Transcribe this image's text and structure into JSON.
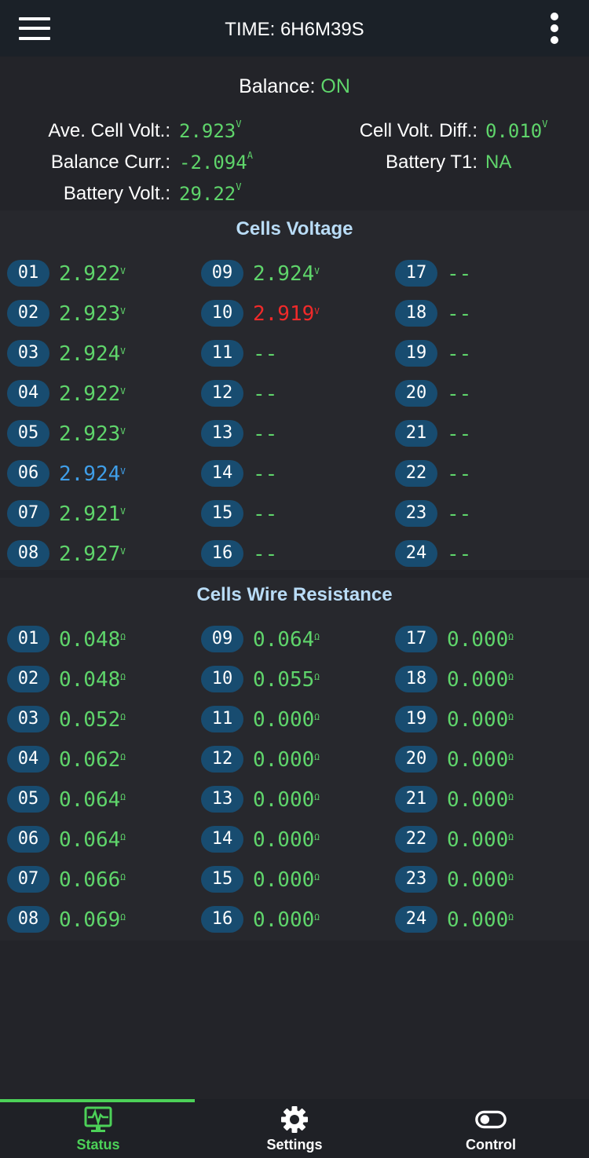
{
  "header": {
    "title": "TIME: 6H6M39S"
  },
  "summary": {
    "balance_label": "Balance: ",
    "balance_value": "ON",
    "ave_cell_volt_label": "Ave. Cell Volt.:",
    "ave_cell_volt_value": "2.923",
    "ave_cell_volt_unit": "V",
    "cell_volt_diff_label": "Cell Volt. Diff.:",
    "cell_volt_diff_value": "0.010",
    "cell_volt_diff_unit": "V",
    "balance_curr_label": "Balance Curr.:",
    "balance_curr_value": "-2.094",
    "balance_curr_unit": "A",
    "battery_t1_label": "Battery T1:",
    "battery_t1_value": "NA",
    "battery_volt_label": "Battery Volt.:",
    "battery_volt_value": "29.22",
    "battery_volt_unit": "V"
  },
  "cells_voltage": {
    "title": "Cells Voltage",
    "unit": "V",
    "items": [
      {
        "id": "01",
        "value": "2.922",
        "unit": "V",
        "color": "#5fd56b"
      },
      {
        "id": "02",
        "value": "2.923",
        "unit": "V",
        "color": "#5fd56b"
      },
      {
        "id": "03",
        "value": "2.924",
        "unit": "V",
        "color": "#5fd56b"
      },
      {
        "id": "04",
        "value": "2.922",
        "unit": "V",
        "color": "#5fd56b"
      },
      {
        "id": "05",
        "value": "2.923",
        "unit": "V",
        "color": "#5fd56b"
      },
      {
        "id": "06",
        "value": "2.924",
        "unit": "V",
        "color": "#3f9ee8"
      },
      {
        "id": "07",
        "value": "2.921",
        "unit": "V",
        "color": "#5fd56b"
      },
      {
        "id": "08",
        "value": "2.927",
        "unit": "V",
        "color": "#5fd56b"
      },
      {
        "id": "09",
        "value": "2.924",
        "unit": "V",
        "color": "#5fd56b"
      },
      {
        "id": "10",
        "value": "2.919",
        "unit": "V",
        "color": "#f02a2a"
      },
      {
        "id": "11",
        "value": "--",
        "unit": "",
        "color": "#5fd56b"
      },
      {
        "id": "12",
        "value": "--",
        "unit": "",
        "color": "#5fd56b"
      },
      {
        "id": "13",
        "value": "--",
        "unit": "",
        "color": "#5fd56b"
      },
      {
        "id": "14",
        "value": "--",
        "unit": "",
        "color": "#5fd56b"
      },
      {
        "id": "15",
        "value": "--",
        "unit": "",
        "color": "#5fd56b"
      },
      {
        "id": "16",
        "value": "--",
        "unit": "",
        "color": "#5fd56b"
      },
      {
        "id": "17",
        "value": "--",
        "unit": "",
        "color": "#5fd56b"
      },
      {
        "id": "18",
        "value": "--",
        "unit": "",
        "color": "#5fd56b"
      },
      {
        "id": "19",
        "value": "--",
        "unit": "",
        "color": "#5fd56b"
      },
      {
        "id": "20",
        "value": "--",
        "unit": "",
        "color": "#5fd56b"
      },
      {
        "id": "21",
        "value": "--",
        "unit": "",
        "color": "#5fd56b"
      },
      {
        "id": "22",
        "value": "--",
        "unit": "",
        "color": "#5fd56b"
      },
      {
        "id": "23",
        "value": "--",
        "unit": "",
        "color": "#5fd56b"
      },
      {
        "id": "24",
        "value": "--",
        "unit": "",
        "color": "#5fd56b"
      }
    ]
  },
  "cells_resistance": {
    "title": "Cells Wire Resistance",
    "items": [
      {
        "id": "01",
        "value": "0.048",
        "unit": "Ω"
      },
      {
        "id": "02",
        "value": "0.048",
        "unit": "Ω"
      },
      {
        "id": "03",
        "value": "0.052",
        "unit": "Ω"
      },
      {
        "id": "04",
        "value": "0.062",
        "unit": "Ω"
      },
      {
        "id": "05",
        "value": "0.064",
        "unit": "Ω"
      },
      {
        "id": "06",
        "value": "0.064",
        "unit": "Ω"
      },
      {
        "id": "07",
        "value": "0.066",
        "unit": "Ω"
      },
      {
        "id": "08",
        "value": "0.069",
        "unit": "Ω"
      },
      {
        "id": "09",
        "value": "0.064",
        "unit": "Ω"
      },
      {
        "id": "10",
        "value": "0.055",
        "unit": "Ω"
      },
      {
        "id": "11",
        "value": "0.000",
        "unit": "Ω"
      },
      {
        "id": "12",
        "value": "0.000",
        "unit": "Ω"
      },
      {
        "id": "13",
        "value": "0.000",
        "unit": "Ω"
      },
      {
        "id": "14",
        "value": "0.000",
        "unit": "Ω"
      },
      {
        "id": "15",
        "value": "0.000",
        "unit": "Ω"
      },
      {
        "id": "16",
        "value": "0.000",
        "unit": "Ω"
      },
      {
        "id": "17",
        "value": "0.000",
        "unit": "Ω"
      },
      {
        "id": "18",
        "value": "0.000",
        "unit": "Ω"
      },
      {
        "id": "19",
        "value": "0.000",
        "unit": "Ω"
      },
      {
        "id": "20",
        "value": "0.000",
        "unit": "Ω"
      },
      {
        "id": "21",
        "value": "0.000",
        "unit": "Ω"
      },
      {
        "id": "22",
        "value": "0.000",
        "unit": "Ω"
      },
      {
        "id": "23",
        "value": "0.000",
        "unit": "Ω"
      },
      {
        "id": "24",
        "value": "0.000",
        "unit": "Ω"
      }
    ]
  },
  "nav": {
    "status_label": "Status",
    "settings_label": "Settings",
    "control_label": "Control",
    "active": "Status",
    "accent_color": "#4cd158",
    "status_icon": "monitor-pulse-icon",
    "settings_icon": "gear-icon",
    "control_icon": "toggle-icon"
  }
}
